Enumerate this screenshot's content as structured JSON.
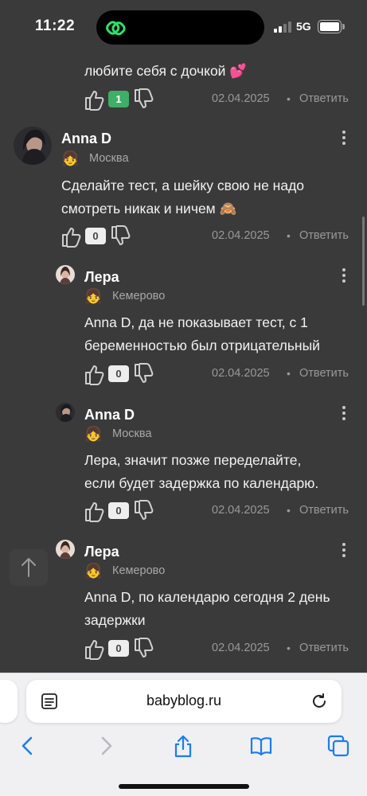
{
  "status_bar": {
    "time": "11:22",
    "network": "5G"
  },
  "comments": [
    {
      "text_lines": [
        "любите себя с дочкой 💕"
      ],
      "votes": "1",
      "date": "02.04.2025",
      "dot": "•",
      "reply": "Ответить"
    },
    {
      "author": "Anna D",
      "city": "Москва",
      "emoji": "👧",
      "text_lines": [
        "Сделайте тест, а шейку свою не надо",
        "смотреть никак и ничем 🙈"
      ],
      "votes": "0",
      "date": "02.04.2025",
      "dot": "•",
      "reply": "Ответить"
    },
    {
      "author": "Лера",
      "city": "Кемерово",
      "emoji": "👧",
      "text_lines": [
        "Anna D, да не показывает тест, с 1",
        "беременностью был отрицательный"
      ],
      "votes": "0",
      "date": "02.04.2025",
      "dot": "•",
      "reply": "Ответить"
    },
    {
      "author": "Anna D",
      "city": "Москва",
      "emoji": "👧",
      "text_lines": [
        "Лера, значит позже переделайте,",
        "если будет задержка по календарю."
      ],
      "votes": "0",
      "date": "02.04.2025",
      "dot": "•",
      "reply": "Ответить"
    },
    {
      "author": "Лера",
      "city": "Кемерово",
      "emoji": "👧",
      "text_lines": [
        "Anna D, по календарю сегодня 2 день",
        "задержки"
      ],
      "votes": "0",
      "date": "02.04.2025",
      "dot": "•",
      "reply": "Ответить"
    }
  ],
  "browser": {
    "url": "babyblog.ru"
  },
  "icons": {
    "like": "thumbs-up-icon",
    "dislike": "thumbs-down-icon",
    "more": "kebab-menu-icon",
    "scroll_top": "arrow-up-icon",
    "reader": "reader-mode-icon",
    "reload": "reload-icon",
    "back": "back-chevron-icon",
    "forward": "forward-chevron-icon",
    "share": "share-icon",
    "bookmarks": "bookmarks-icon",
    "tabs": "tabs-icon"
  },
  "colors": {
    "background": "#3a3a3a",
    "vote_positive": "#3fae66",
    "accent_blue": "#1a7cf5"
  }
}
